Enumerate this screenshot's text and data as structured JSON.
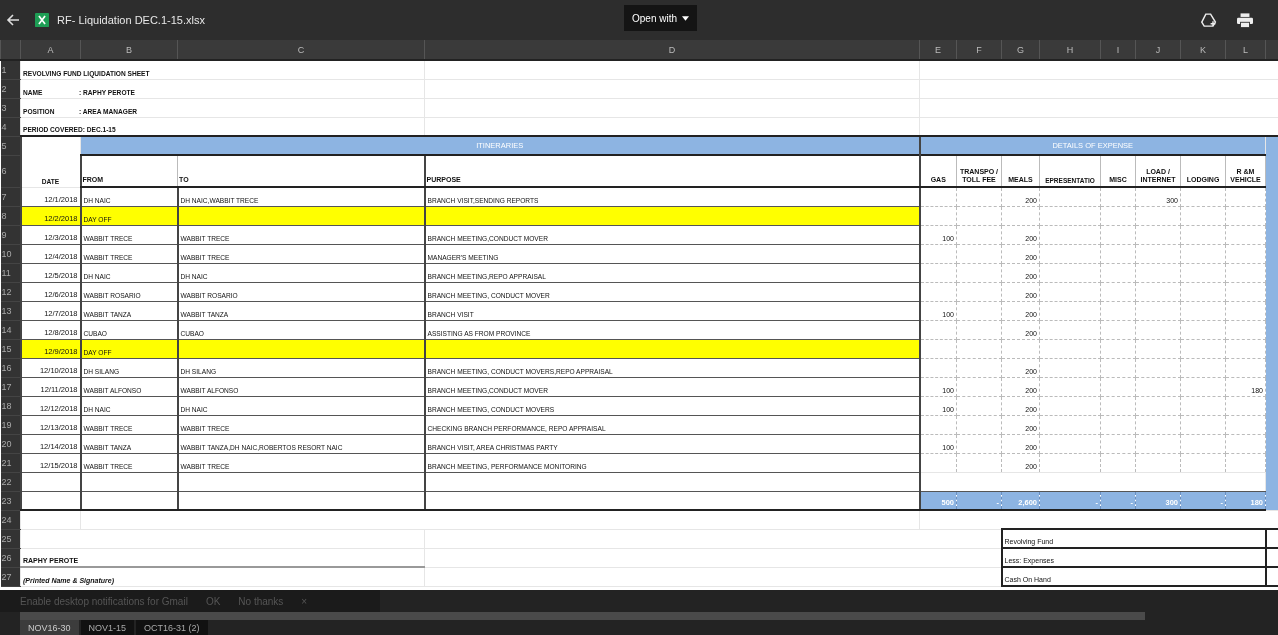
{
  "window": {
    "title": "RF- Liquidation DEC.1-15.xlsx",
    "open_with": "Open with"
  },
  "columns": [
    "A",
    "B",
    "C",
    "D",
    "E",
    "F",
    "G",
    "H",
    "I",
    "J",
    "K",
    "L"
  ],
  "row_numbers": [
    "1",
    "2",
    "3",
    "4",
    "5",
    "6",
    "7",
    "8",
    "9",
    "10",
    "11",
    "12",
    "13",
    "14",
    "15",
    "16",
    "17",
    "18",
    "19",
    "20",
    "21",
    "22",
    "23",
    "24",
    "25",
    "26",
    "27"
  ],
  "sheet": {
    "title": "REVOLVING FUND LIQUIDATION SHEET",
    "name_label": "NAME",
    "name_value": ": RAPHY PEROTE",
    "position_label": "POSITION",
    "position_value": ": AREA MANAGER",
    "period": "PERIOD COVERED: DEC.1-15"
  },
  "sections": [
    "ITINERARIES",
    "DETAILS OF EXPENSE"
  ],
  "headers": [
    "DATE",
    "FROM",
    "TO",
    "PURPOSE",
    "GAS",
    "TRANSPO / TOLL FEE",
    "MEALS",
    "EPRESENTATIO",
    "MISC",
    "LOAD / INTERNET",
    "LODGING",
    "R &M VEHICLE"
  ],
  "entries": [
    {
      "date": "12/1/2018",
      "from": "DH NAIC",
      "to": "DH NAIC,WABBIT TRECE",
      "purpose": "BRANCH VISIT,SENDING REPORTS",
      "highlighted": false,
      "amounts": {
        "meals": "200",
        "load": "300"
      }
    },
    {
      "date": "12/2/2018",
      "from": "DAY OFF",
      "highlighted": true
    },
    {
      "date": "12/3/2018",
      "from": "WABBIT TRECE",
      "to": "WABBIT TRECE",
      "purpose": "BRANCH MEETING,CONDUCT MOVER",
      "highlighted": false,
      "amounts": {
        "gas": "100",
        "meals": "200"
      }
    },
    {
      "date": "12/4/2018",
      "from": "WABBIT TRECE",
      "to": "WABBIT TRECE",
      "purpose": "MANAGER'S MEETING",
      "highlighted": false,
      "amounts": {
        "meals": "200"
      }
    },
    {
      "date": "12/5/2018",
      "from": "DH NAIC",
      "to": "DH NAIC",
      "purpose": "BRANCH MEETING,REPO APPRAISAL",
      "highlighted": false,
      "amounts": {
        "meals": "200"
      }
    },
    {
      "date": "12/6/2018",
      "from": "WABBIT ROSARIO",
      "to": "WABBIT ROSARIO",
      "purpose": "BRANCH MEETING, CONDUCT MOVER",
      "highlighted": false,
      "amounts": {
        "meals": "200"
      }
    },
    {
      "date": "12/7/2018",
      "from": "WABBIT TANZA",
      "to": "WABBIT TANZA",
      "purpose": "BRANCH VISIT",
      "highlighted": false,
      "amounts": {
        "gas": "100",
        "meals": "200"
      }
    },
    {
      "date": "12/8/2018",
      "from": "CUBAO",
      "to": "CUBAO",
      "purpose": "ASSISTING  AS FROM PROVINCE",
      "highlighted": false,
      "amounts": {
        "meals": "200"
      }
    },
    {
      "date": "12/9/2018",
      "from": "DAY OFF",
      "highlighted": true
    },
    {
      "date": "12/10/2018",
      "from": "DH SILANG",
      "to": "DH SILANG",
      "purpose": "BRANCH MEETING, CONDUCT MOVERS,REPO APPRAISAL",
      "highlighted": false,
      "amounts": {
        "meals": "200"
      }
    },
    {
      "date": "12/11/2018",
      "from": "WABBIT ALFONSO",
      "to": "WABBIT ALFONSO",
      "purpose": "BRANCH MEETING,CONDUCT MOVER",
      "highlighted": false,
      "amounts": {
        "gas": "100",
        "meals": "200",
        "rm": "180"
      }
    },
    {
      "date": "12/12/2018",
      "from": "DH NAIC",
      "to": "DH NAIC",
      "purpose": "BRANCH MEETING, CONDUCT MOVERS",
      "highlighted": false,
      "amounts": {
        "gas": "100",
        "meals": "200"
      }
    },
    {
      "date": "12/13/2018",
      "from": "WABBIT TRECE",
      "to": "WABBIT TRECE",
      "purpose": "CHECKING BRANCH PERFORMANCE, REPO APPRAISAL",
      "highlighted": false,
      "amounts": {
        "meals": "200"
      }
    },
    {
      "date": "12/14/2018",
      "from": "WABBIT TANZA",
      "to": "WABBIT TANZA,DH NAIC,ROBERTOS RESORT NAIC",
      "purpose": "BRANCH VISIT,  AREA CHRISTMAS PARTY",
      "highlighted": false,
      "amounts": {
        "gas": "100",
        "meals": "200"
      }
    },
    {
      "date": "12/15/2018",
      "from": "WABBIT TRECE",
      "to": "WABBIT TRECE",
      "purpose": "BRANCH MEETING, PERFORMANCE MONITORING",
      "highlighted": false,
      "amounts": {
        "meals": "200"
      }
    }
  ],
  "totals": [
    "500",
    "-",
    "2,600",
    "-",
    "-",
    "300",
    "-",
    "180"
  ],
  "signature": {
    "name": "RAPHY PEROTE",
    "caption": "(Printed Name & Signature)"
  },
  "summary": [
    "Revolving Fund",
    "Less: Expenses",
    "Cash On Hand"
  ],
  "notification": {
    "text": "Enable desktop notifications for Gmail",
    "ok": "OK",
    "dismiss": "No thanks",
    "close": "×"
  },
  "sheet_tabs": [
    {
      "label": "NOV16-30",
      "selected": true
    },
    {
      "label": "NOV1-15",
      "selected": false
    },
    {
      "label": "OCT16-31 (2)",
      "selected": false
    }
  ]
}
